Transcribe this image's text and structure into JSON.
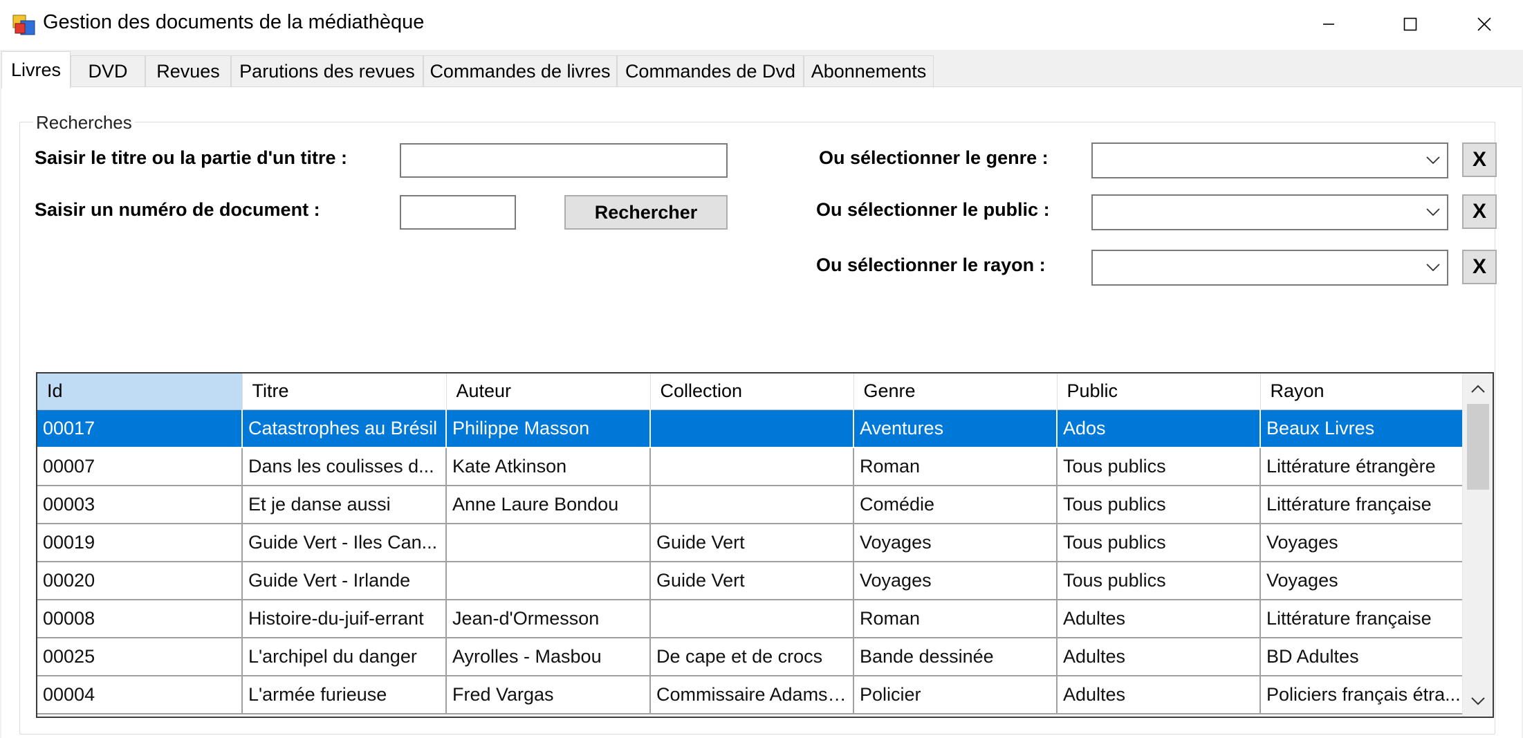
{
  "window": {
    "title": "Gestion des documents de la médiathèque",
    "controls": [
      "minimize-icon",
      "maximize-icon",
      "close-icon"
    ]
  },
  "tabs": [
    {
      "label": "Livres",
      "active": true
    },
    {
      "label": "DVD",
      "active": false
    },
    {
      "label": "Revues",
      "active": false
    },
    {
      "label": "Parutions des revues",
      "active": false
    },
    {
      "label": "Commandes de livres",
      "active": false
    },
    {
      "label": "Commandes de Dvd",
      "active": false
    },
    {
      "label": "Abonnements",
      "active": false
    }
  ],
  "search": {
    "group_title": "Recherches",
    "title_label": "Saisir le titre ou la partie d'un titre :",
    "title_value": "",
    "number_label": "Saisir un numéro de document :",
    "number_value": "",
    "search_button": "Rechercher",
    "genre_label": "Ou sélectionner le genre :",
    "genre_value": "",
    "public_label": "Ou sélectionner le public :",
    "public_value": "",
    "rayon_label": "Ou sélectionner le rayon :",
    "rayon_value": "",
    "clear_label": "X"
  },
  "grid": {
    "columns": [
      "Id",
      "Titre",
      "Auteur",
      "Collection",
      "Genre",
      "Public",
      "Rayon"
    ],
    "rows": [
      [
        "00017",
        "Catastrophes au Brésil",
        "Philippe Masson",
        "",
        "Aventures",
        "Ados",
        "Beaux Livres"
      ],
      [
        "00007",
        "Dans les coulisses d...",
        "Kate Atkinson",
        "",
        "Roman",
        "Tous publics",
        "Littérature étrangère"
      ],
      [
        "00003",
        "Et je danse aussi",
        "Anne Laure Bondou",
        "",
        "Comédie",
        "Tous publics",
        "Littérature française"
      ],
      [
        "00019",
        "Guide Vert - Iles Can...",
        "",
        "Guide Vert",
        "Voyages",
        "Tous publics",
        "Voyages"
      ],
      [
        "00020",
        "Guide Vert - Irlande",
        "",
        "Guide Vert",
        "Voyages",
        "Tous publics",
        "Voyages"
      ],
      [
        "00008",
        "Histoire-du-juif-errant",
        "Jean-d'Ormesson",
        "",
        "Roman",
        "Adultes",
        "Littérature française"
      ],
      [
        "00025",
        "L'archipel du danger",
        "Ayrolles - Masbou",
        "De cape et de crocs",
        "Bande dessinée",
        "Adultes",
        "BD Adultes"
      ],
      [
        "00004",
        "L'armée furieuse",
        "Fred Vargas",
        "Commissaire Adamsb...",
        "Policier",
        "Adultes",
        "Policiers français étra..."
      ]
    ],
    "selected_row": 0,
    "selection_color": "#0078d7"
  }
}
